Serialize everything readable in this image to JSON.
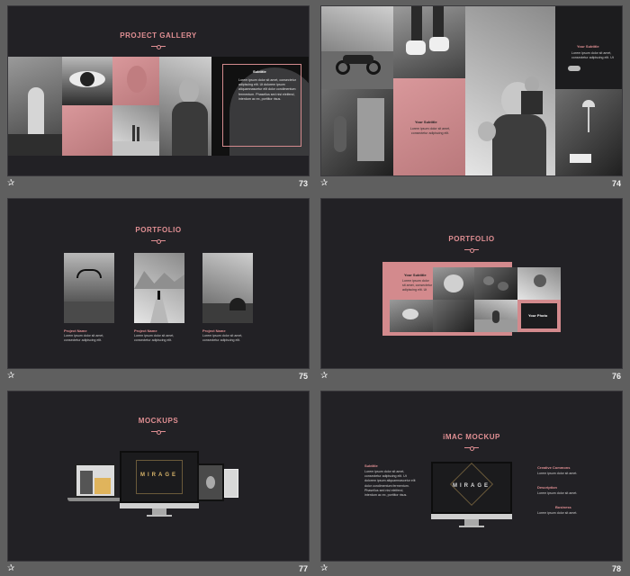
{
  "footer": {
    "star": "✰"
  },
  "slides": {
    "s73": {
      "number": "73",
      "title": "PROJECT GALLERY",
      "subtitle": "Subtitle",
      "text": "Lorem ipsum dolor sit amet, consectetur adipiscing elit. Ut dolorem ipsum aliquamnascetur elit dolor condimentum fermentum. Phasellus sed nisi eleifend, interdum ac ex, porttitor risus."
    },
    "s74": {
      "number": "74",
      "subtitle_a": "Your Subtitle",
      "text_a": "Lorem ipsum dolor sit amet, consectetur adipiscing elit.",
      "subtitle_b": "Your Subtitle",
      "text_b": "Lorem ipsum dolor sit amet, consectetur adipiscing elit. Ut"
    },
    "s75": {
      "number": "75",
      "title": "PORTFOLIO",
      "projects": [
        {
          "name": "Project Name",
          "text": "Lorem ipsum dolor sit amet, consectetur adipiscing elit."
        },
        {
          "name": "Project Name",
          "text": "Lorem ipsum dolor sit amet, consectetur adipiscing elit."
        },
        {
          "name": "Project Name",
          "text": "Lorem ipsum dolor sit amet, consectetur adipiscing elit."
        }
      ]
    },
    "s76": {
      "number": "76",
      "title": "PORTFOLIO",
      "subtitle": "Your Subtitle",
      "text": "Lorem ipsum dolor sit amet, consectetur adipiscing elit. Ut",
      "photo_label": "Your Photo"
    },
    "s77": {
      "number": "77",
      "title": "MOCKUPS",
      "screen_word": "MIRAGE"
    },
    "s78": {
      "number": "78",
      "title": "iMAC MOCKUP",
      "subtitle": "Subtitle",
      "text": "Lorem ipsum dolor sit amet, consectetur adipiscing elit. Ut dolorem ipsum aliquamnascetur elit dolor condimentum fermentum. Phasellus sed nisi eleifend, interdum ac ex, porttitor risus.",
      "screen_word": "MIRAGE",
      "right_items": [
        {
          "title": "Creative Commons",
          "text": "Lorem ipsum dolor sit amet."
        },
        {
          "title": "Description",
          "text": "Lorem ipsum dolor sit amet."
        },
        {
          "title": "Business",
          "text": "Lorem ipsum dolor sit amet."
        }
      ]
    }
  }
}
